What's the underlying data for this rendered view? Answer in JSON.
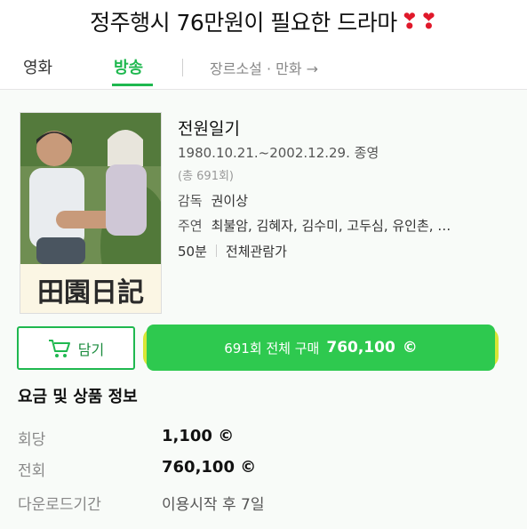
{
  "caption": "정주행시 76만원이 필요한 드라마",
  "tabs": {
    "movie": "영화",
    "broadcast": "방송",
    "genre": "장르소설 · 만화 →"
  },
  "show": {
    "title": "전원일기",
    "dates": "1980.10.21.~2002.12.29. 종영",
    "total": "(총 691회)",
    "director_label": "감독",
    "director": "권이상",
    "cast_label": "주연",
    "cast": "최불암, 김혜자, 김수미, 고두심, 유인촌, …",
    "runtime": "50분",
    "rating": "전체관람가",
    "poster_logo": "田園日記"
  },
  "actions": {
    "cart_label": "담기",
    "buy_label": "691회 전체 구매",
    "buy_amount": "760,100",
    "coin_symbol": "©"
  },
  "info": {
    "title": "요금 및 상품 정보",
    "episode_label": "회당",
    "episode_price": "1,100 ©",
    "full_label": "전회",
    "full_price": "760,100 ©",
    "download_label": "다운로드기간",
    "download_value": "이용시작 후 7일"
  },
  "colors": {
    "accent": "#1fb84f",
    "buy_button": "#2ec94f",
    "highlight": "#d8e636",
    "heart": "#e0182a"
  }
}
